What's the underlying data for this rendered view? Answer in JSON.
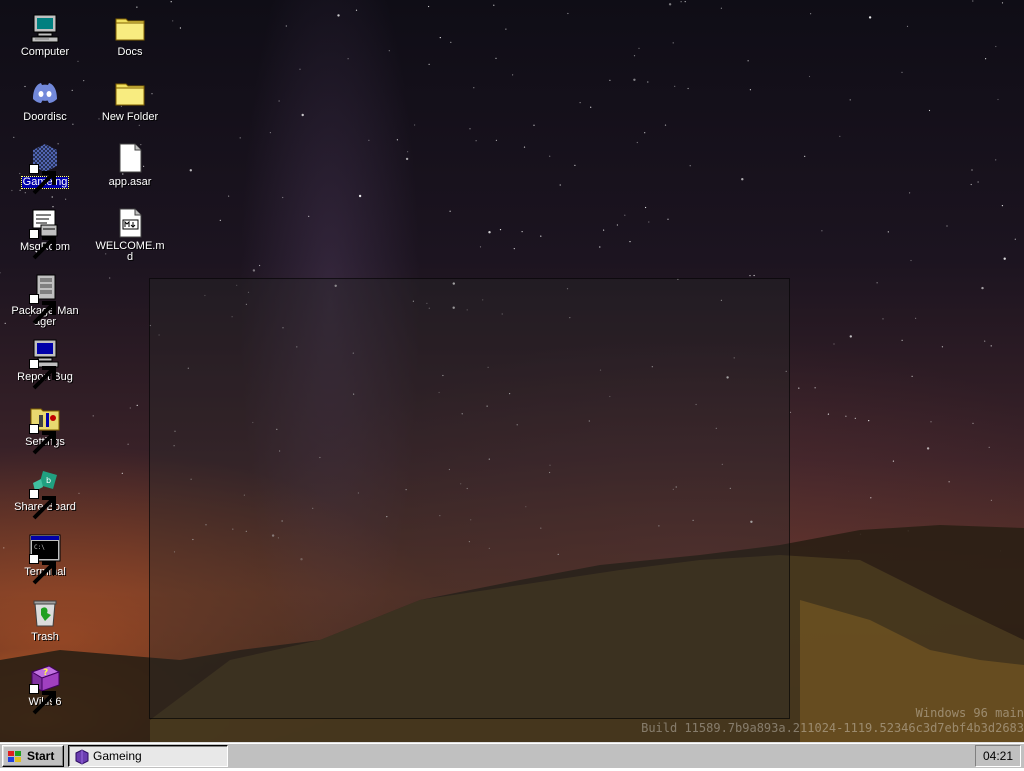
{
  "desktop": {
    "icons": [
      {
        "name": "computer",
        "label": "Computer",
        "icon": "computer-icon"
      },
      {
        "name": "doordisc",
        "label": "Doordisc",
        "icon": "discord-icon"
      },
      {
        "name": "gameing",
        "label": "Gameing",
        "icon": "game-icon"
      },
      {
        "name": "msgroom",
        "label": "MsgRoom",
        "icon": "chat-icon"
      },
      {
        "name": "package-manager",
        "label": "Package Manager",
        "icon": "package-icon"
      },
      {
        "name": "report-bug",
        "label": "Report Bug",
        "icon": "bug-report-icon"
      },
      {
        "name": "settings",
        "label": "Settings",
        "icon": "settings-icon"
      },
      {
        "name": "share-board",
        "label": "Share Board",
        "icon": "share-board-icon"
      },
      {
        "name": "terminal",
        "label": "Terminal",
        "icon": "terminal-icon"
      },
      {
        "name": "trash",
        "label": "Trash",
        "icon": "trash-icon"
      },
      {
        "name": "wiki96",
        "label": "Wiki96",
        "icon": "wiki-book-icon"
      },
      {
        "name": "docs",
        "label": "Docs",
        "icon": "folder-icon"
      },
      {
        "name": "new-folder",
        "label": "New Folder",
        "icon": "folder-icon"
      },
      {
        "name": "app-asar",
        "label": "app.asar",
        "icon": "file-icon"
      },
      {
        "name": "welcome-md",
        "label": "WELCOME.md",
        "icon": "markdown-file-icon"
      }
    ],
    "selected": "Gameing"
  },
  "watermark": {
    "line1": "Windows 96 main",
    "line2": "Build 11589.7b9a893a.211024-1119.52346c3d7ebf4b3d2683"
  },
  "taskbar": {
    "start_label": "Start",
    "tasks": [
      {
        "label": "Gameing",
        "icon": "game-icon"
      }
    ],
    "clock": "04:21"
  },
  "colors": {
    "taskbar": "#c0c0c0",
    "selection_highlight": "#0000a8",
    "folder": "#f0e060"
  }
}
